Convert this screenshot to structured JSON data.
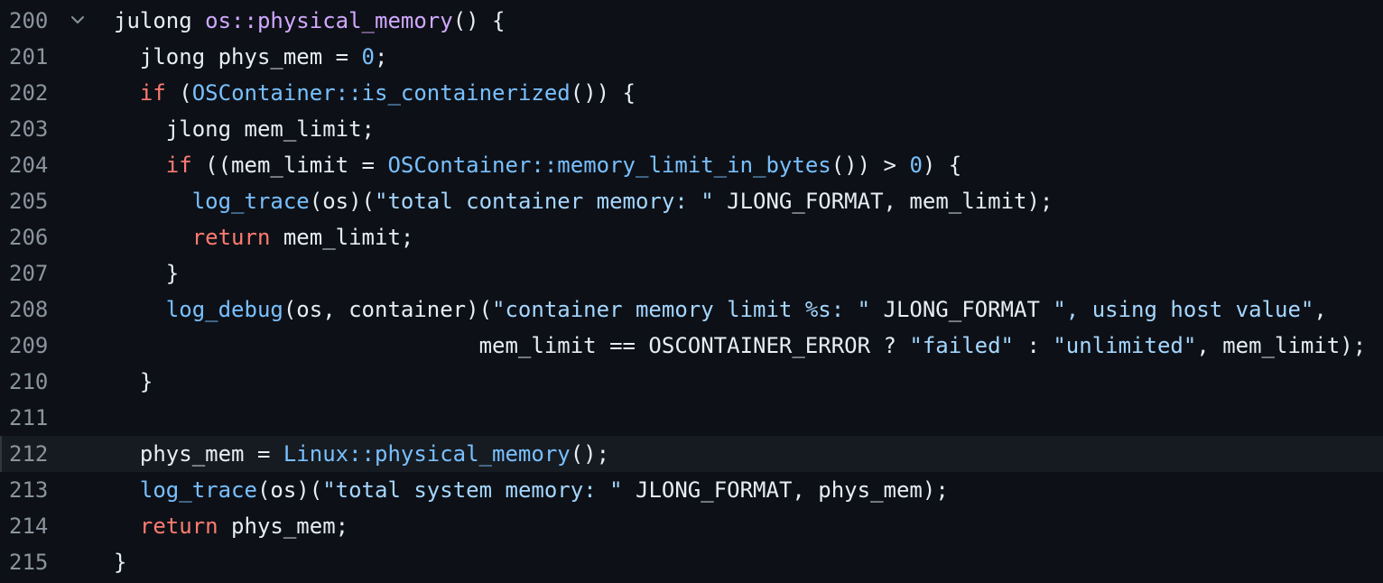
{
  "editor": {
    "theme_colors": {
      "background": "#0d1117",
      "line_number": "#8b949e",
      "keyword": "#ff7b72",
      "function_call": "#79c0ff",
      "string": "#a5d6ff",
      "function_def": "#d2a8ff",
      "plain": "#e6edf3",
      "active_line": "#161b22"
    },
    "fold_icon": "chevron-down-icon",
    "active_line_number": "212",
    "lines": [
      {
        "number": "200",
        "foldable": true,
        "tokens": [
          {
            "t": "julong ",
            "c": "plain"
          },
          {
            "t": "os::physical_memory",
            "c": "def"
          },
          {
            "t": "() {",
            "c": "plain"
          }
        ]
      },
      {
        "number": "201",
        "tokens": [
          {
            "t": "  jlong phys_mem = ",
            "c": "plain"
          },
          {
            "t": "0",
            "c": "num"
          },
          {
            "t": ";",
            "c": "plain"
          }
        ]
      },
      {
        "number": "202",
        "tokens": [
          {
            "t": "  ",
            "c": "plain"
          },
          {
            "t": "if",
            "c": "kw"
          },
          {
            "t": " (",
            "c": "plain"
          },
          {
            "t": "OSContainer::is_containerized",
            "c": "fn"
          },
          {
            "t": "()) {",
            "c": "plain"
          }
        ]
      },
      {
        "number": "203",
        "tokens": [
          {
            "t": "    jlong mem_limit;",
            "c": "plain"
          }
        ]
      },
      {
        "number": "204",
        "tokens": [
          {
            "t": "    ",
            "c": "plain"
          },
          {
            "t": "if",
            "c": "kw"
          },
          {
            "t": " ((mem_limit = ",
            "c": "plain"
          },
          {
            "t": "OSContainer::memory_limit_in_bytes",
            "c": "fn"
          },
          {
            "t": "()) > ",
            "c": "plain"
          },
          {
            "t": "0",
            "c": "num"
          },
          {
            "t": ") {",
            "c": "plain"
          }
        ]
      },
      {
        "number": "205",
        "tokens": [
          {
            "t": "      ",
            "c": "plain"
          },
          {
            "t": "log_trace",
            "c": "fn"
          },
          {
            "t": "(os)(",
            "c": "plain"
          },
          {
            "t": "\"total container memory: \"",
            "c": "str"
          },
          {
            "t": " JLONG_FORMAT, mem_limit);",
            "c": "plain"
          }
        ]
      },
      {
        "number": "206",
        "tokens": [
          {
            "t": "      ",
            "c": "plain"
          },
          {
            "t": "return",
            "c": "kw"
          },
          {
            "t": " mem_limit;",
            "c": "plain"
          }
        ]
      },
      {
        "number": "207",
        "tokens": [
          {
            "t": "    }",
            "c": "plain"
          }
        ]
      },
      {
        "number": "208",
        "tokens": [
          {
            "t": "    ",
            "c": "plain"
          },
          {
            "t": "log_debug",
            "c": "fn"
          },
          {
            "t": "(os, container)(",
            "c": "plain"
          },
          {
            "t": "\"container memory limit %s: \"",
            "c": "str"
          },
          {
            "t": " JLONG_FORMAT ",
            "c": "plain"
          },
          {
            "t": "\", using host value\"",
            "c": "str"
          },
          {
            "t": ",",
            "c": "plain"
          }
        ]
      },
      {
        "number": "209",
        "tokens": [
          {
            "t": "                            mem_limit == OSCONTAINER_ERROR ? ",
            "c": "plain"
          },
          {
            "t": "\"failed\"",
            "c": "str"
          },
          {
            "t": " : ",
            "c": "plain"
          },
          {
            "t": "\"unlimited\"",
            "c": "str"
          },
          {
            "t": ", mem_limit);",
            "c": "plain"
          }
        ]
      },
      {
        "number": "210",
        "tokens": [
          {
            "t": "  }",
            "c": "plain"
          }
        ]
      },
      {
        "number": "211",
        "tokens": []
      },
      {
        "number": "212",
        "tokens": [
          {
            "t": "  phys_mem = ",
            "c": "plain"
          },
          {
            "t": "Linux::physical_memory",
            "c": "fn"
          },
          {
            "t": "();",
            "c": "plain"
          }
        ]
      },
      {
        "number": "213",
        "tokens": [
          {
            "t": "  ",
            "c": "plain"
          },
          {
            "t": "log_trace",
            "c": "fn"
          },
          {
            "t": "(os)(",
            "c": "plain"
          },
          {
            "t": "\"total system memory: \"",
            "c": "str"
          },
          {
            "t": " JLONG_FORMAT, phys_mem);",
            "c": "plain"
          }
        ]
      },
      {
        "number": "214",
        "tokens": [
          {
            "t": "  ",
            "c": "plain"
          },
          {
            "t": "return",
            "c": "kw"
          },
          {
            "t": " phys_mem;",
            "c": "plain"
          }
        ]
      },
      {
        "number": "215",
        "tokens": [
          {
            "t": "}",
            "c": "plain"
          }
        ]
      }
    ]
  }
}
